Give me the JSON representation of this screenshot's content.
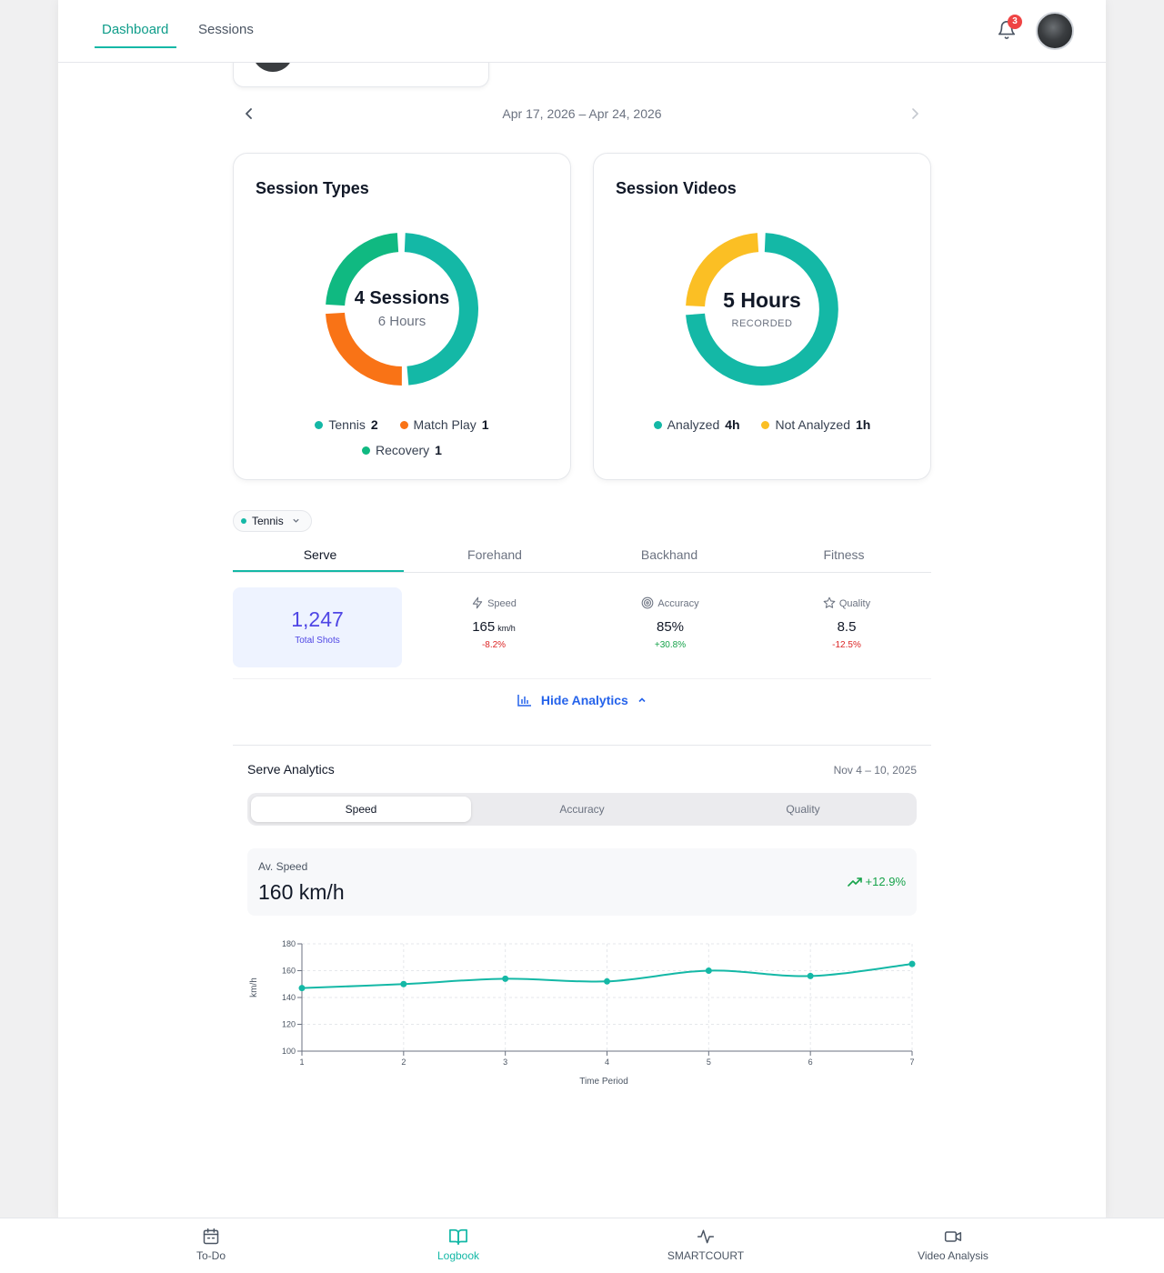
{
  "header": {
    "tabs": [
      {
        "label": "Dashboard",
        "active": true
      },
      {
        "label": "Sessions",
        "active": false
      }
    ],
    "notification_count": "3"
  },
  "date_nav": {
    "range": "Apr 17, 2026 – Apr 24, 2026"
  },
  "session_types": {
    "title": "Session Types",
    "center_main": "4 Sessions",
    "center_sub": "6 Hours",
    "legend": [
      {
        "label": "Tennis",
        "value": "2",
        "color": "#14b8a6"
      },
      {
        "label": "Match Play",
        "value": "1",
        "color": "#f97316"
      },
      {
        "label": "Recovery",
        "value": "1",
        "color": "#10b981"
      }
    ]
  },
  "session_videos": {
    "title": "Session Videos",
    "center_main": "5 Hours",
    "center_sub": "RECORDED",
    "legend": [
      {
        "label": "Analyzed",
        "value": "4h",
        "color": "#14b8a6"
      },
      {
        "label": "Not Analyzed",
        "value": "1h",
        "color": "#fbbf24"
      }
    ]
  },
  "filter": {
    "sport": "Tennis"
  },
  "stroke_tabs": [
    "Serve",
    "Forehand",
    "Backhand",
    "Fitness"
  ],
  "stats": {
    "total_value": "1,247",
    "total_label": "Total Shots",
    "speed": {
      "label": "Speed",
      "value": "165",
      "unit": "km/h",
      "delta": "-8.2%",
      "icon": "lightning-icon"
    },
    "accuracy": {
      "label": "Accuracy",
      "value": "85%",
      "delta": "+30.8%",
      "icon": "target-icon"
    },
    "quality": {
      "label": "Quality",
      "value": "8.5",
      "delta": "-12.5%",
      "icon": "star-icon"
    }
  },
  "hide_analytics_label": "Hide Analytics",
  "analytics": {
    "title": "Serve Analytics",
    "date": "Nov 4 – 10, 2025",
    "segments": [
      "Speed",
      "Accuracy",
      "Quality"
    ],
    "avg_label": "Av. Speed",
    "avg_value": "160 km/h",
    "avg_delta": "+12.9%"
  },
  "chart_data": {
    "type": "line",
    "x": [
      1,
      2,
      3,
      4,
      5,
      6,
      7
    ],
    "series": [
      {
        "values": [
          147,
          150,
          154,
          152,
          160,
          156,
          165
        ]
      }
    ],
    "xlabel": "Time Period",
    "ylabel": "km/h",
    "ylim": [
      100,
      180
    ],
    "yticks": [
      100,
      120,
      140,
      160,
      180
    ],
    "grid": true,
    "color": "#14b8a6"
  },
  "bottom_nav": [
    {
      "label": "To-Do",
      "icon": "calendar-icon"
    },
    {
      "label": "Logbook",
      "icon": "book-icon",
      "active": true
    },
    {
      "label": "SMARTCOURT",
      "icon": "activity-icon"
    },
    {
      "label": "Video Analysis",
      "icon": "video-icon"
    }
  ]
}
